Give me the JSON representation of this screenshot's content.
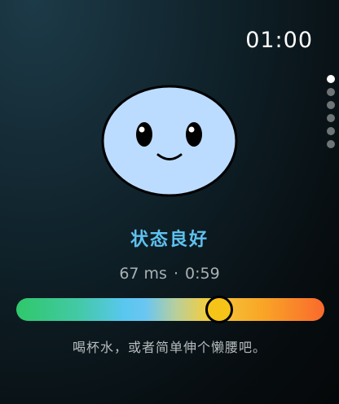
{
  "clock": {
    "time": "01:00"
  },
  "pager": {
    "page_count": 6,
    "active_index": 0
  },
  "mood": {
    "face_icon": "smiling-blob-face-icon",
    "face_color": "#bcdcff",
    "status": "状态良好"
  },
  "metrics": {
    "latency": "67 ms",
    "separator": "·",
    "elapsed": "0:59"
  },
  "scale": {
    "value_fraction": 0.66,
    "thumb_color": "#f6c418"
  },
  "tip": {
    "text": "喝杯水，或者简单伸个懒腰吧。"
  }
}
